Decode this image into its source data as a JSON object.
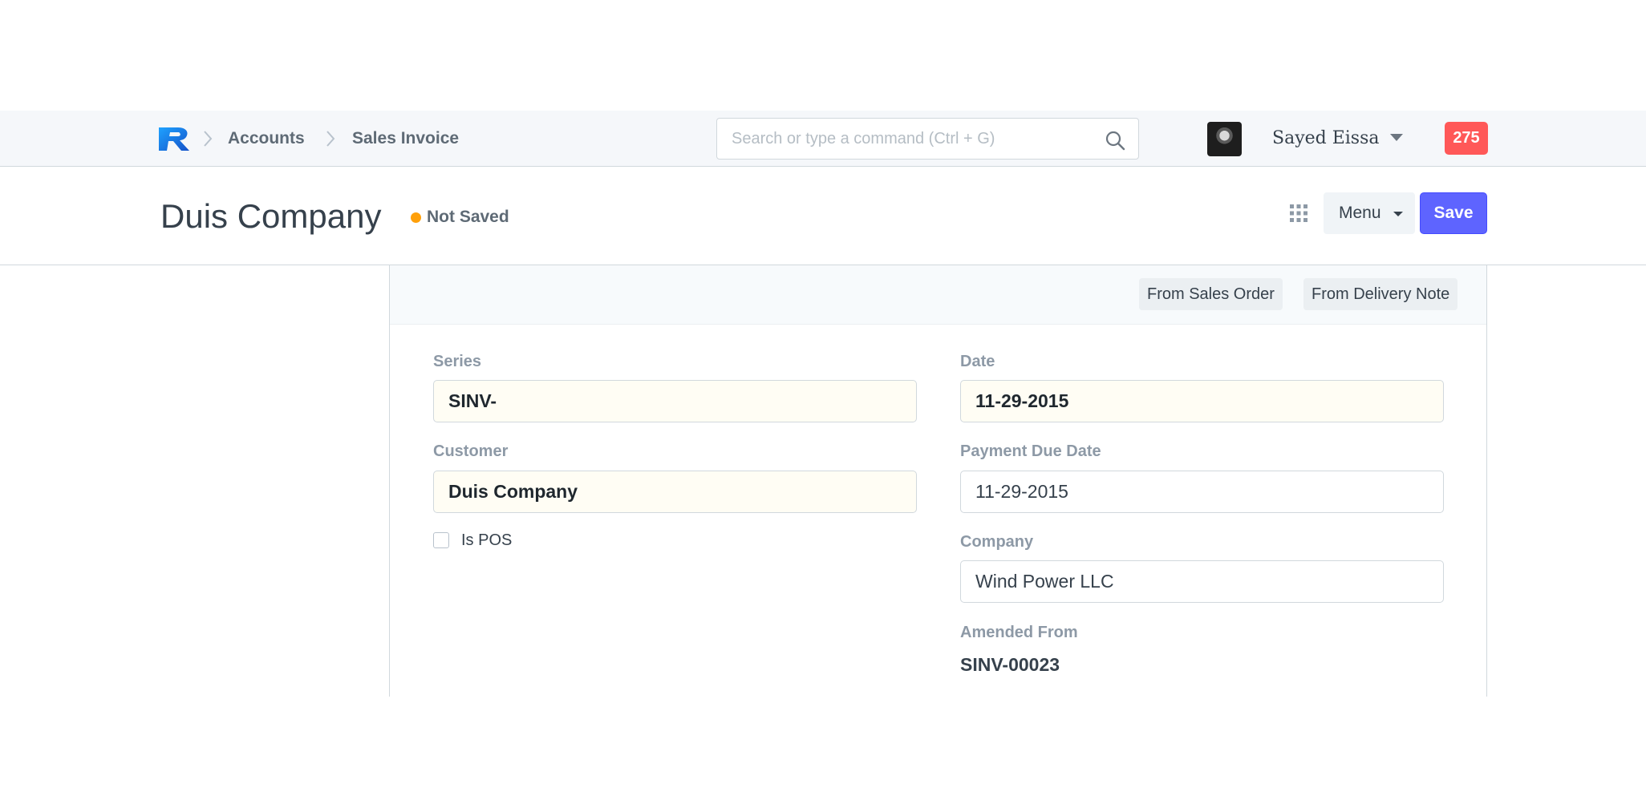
{
  "navbar": {
    "logo_icon": "brand-r-logo",
    "breadcrumbs": [
      "Accounts",
      "Sales Invoice"
    ],
    "search": {
      "placeholder": "Search or type a command (Ctrl + G)",
      "value": ""
    },
    "user": {
      "name": "Sayed Eissa"
    },
    "notifications": {
      "count": "275"
    }
  },
  "page_head": {
    "title": "Duis Company",
    "status": "Not Saved",
    "menu_label": "Menu",
    "save_label": "Save"
  },
  "form": {
    "toolbar_buttons": [
      "From Sales Order",
      "From Delivery Note"
    ],
    "fields": {
      "series": {
        "label": "Series",
        "value": "SINV-"
      },
      "customer": {
        "label": "Customer",
        "value": "Duis Company"
      },
      "is_pos": {
        "label": "Is POS",
        "checked": false
      },
      "date": {
        "label": "Date",
        "value": "11-29-2015"
      },
      "payment_due_date": {
        "label": "Payment Due Date",
        "value": "11-29-2015"
      },
      "company": {
        "label": "Company",
        "value": "Wind Power LLC"
      },
      "amended_from": {
        "label": "Amended From",
        "value": "SINV-00023"
      }
    }
  },
  "colors": {
    "primary": "#5e64ff",
    "badge": "#ff5858",
    "status_dot": "#ffa00a",
    "mandatory_field_bg": "#fffdf4"
  }
}
